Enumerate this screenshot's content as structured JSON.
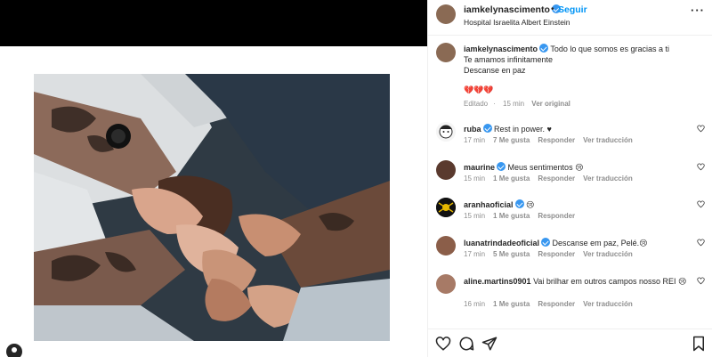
{
  "post": {
    "username": "iamkelynascimento",
    "follow_label": "Seguir",
    "separator": "•",
    "location": "Hospital Israelita Albert Einstein",
    "more_label": "···"
  },
  "caption": {
    "username": "iamkelynascimento",
    "line1": "Todo lo que somos es gracias a ti",
    "line2": "Te amamos infinitamente",
    "line3": "Descanse en paz",
    "hearts": "💔💔💔",
    "edited": "Editado",
    "time": "15 min",
    "see_original": "Ver original"
  },
  "comments": [
    {
      "user": "ruba",
      "verified": true,
      "text": "Rest in power. ♥",
      "time": "17 min",
      "likes": "7 Me gusta",
      "reply": "Responder",
      "translate": "Ver traducción"
    },
    {
      "user": "maurine",
      "verified": true,
      "text": "Meus sentimentos 😢",
      "time": "15 min",
      "likes": "1 Me gusta",
      "reply": "Responder",
      "translate": "Ver traducción"
    },
    {
      "user": "aranhaoficial",
      "verified": true,
      "text": "😢",
      "time": "15 min",
      "likes": "1 Me gusta",
      "reply": "Responder",
      "translate": ""
    },
    {
      "user": "luanatrindadeoficial",
      "verified": true,
      "text": "Descanse em paz, Pelé.😢",
      "time": "17 min",
      "likes": "5 Me gusta",
      "reply": "Responder",
      "translate": "Ver traducción"
    },
    {
      "user": "aline.martins0901",
      "verified": false,
      "text": "Vai brilhar em outros campos nosso REI 😢",
      "time": "16 min",
      "likes": "1 Me gusta",
      "reply": "Responder",
      "translate": "Ver traducción"
    }
  ],
  "actions": {
    "like_icon": "heart-icon",
    "comment_icon": "comment-icon",
    "share_icon": "paper-plane-icon",
    "save_icon": "bookmark-icon"
  },
  "colors": {
    "accent": "#0095f6",
    "verified": "#3897f0",
    "muted": "#8e8e8e",
    "text": "#262626"
  }
}
